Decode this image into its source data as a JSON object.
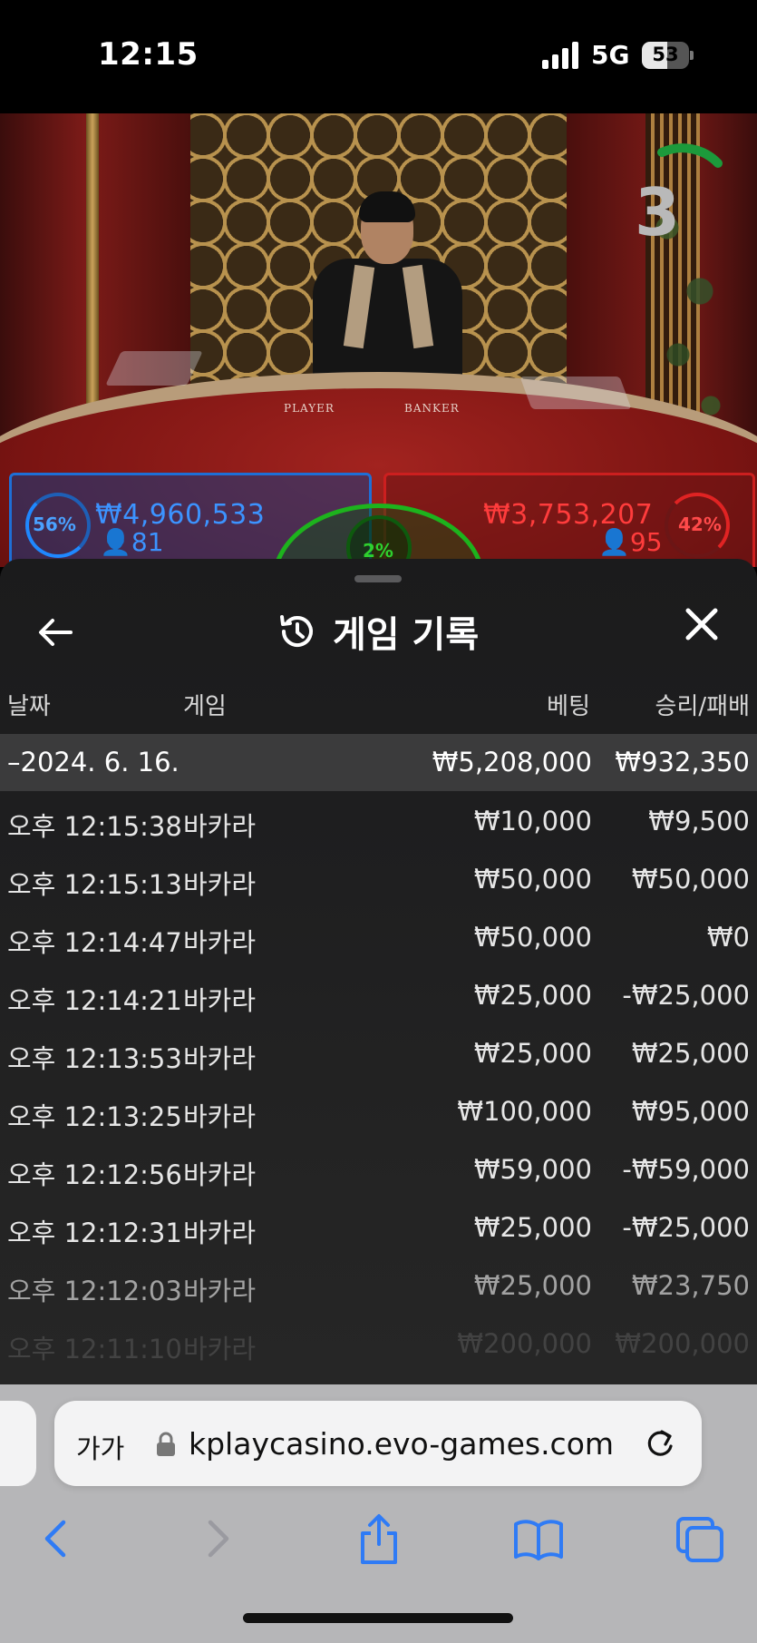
{
  "status_bar": {
    "time": "12:15",
    "network": "5G",
    "battery": "53",
    "battery_level": 0.53
  },
  "game": {
    "countdown": "3",
    "table_labels": {
      "player": "PLAYER",
      "banker": "BANKER"
    },
    "player": {
      "percent": "56%",
      "amount": "₩4,960,533",
      "bettors": "81",
      "color": "#3c93ff"
    },
    "banker": {
      "percent": "42%",
      "amount": "₩3,753,207",
      "bettors": "95",
      "color": "#ff3c3c"
    },
    "tie": {
      "percent": "2%",
      "color": "#2ed02e"
    }
  },
  "history": {
    "title": "게임 기록",
    "columns": {
      "date": "날짜",
      "game": "게임",
      "bet": "베팅",
      "winloss": "승리/패배"
    },
    "summary": {
      "date": "–2024. 6. 16.",
      "bet": "₩5,208,000",
      "winloss": "₩932,350"
    },
    "rows": [
      {
        "time": "오후 12:15:38",
        "game": "바카라",
        "bet": "₩10,000",
        "winloss": "₩9,500"
      },
      {
        "time": "오후 12:15:13",
        "game": "바카라",
        "bet": "₩50,000",
        "winloss": "₩50,000"
      },
      {
        "time": "오후 12:14:47",
        "game": "바카라",
        "bet": "₩50,000",
        "winloss": "₩0"
      },
      {
        "time": "오후 12:14:21",
        "game": "바카라",
        "bet": "₩25,000",
        "winloss": "-₩25,000"
      },
      {
        "time": "오후 12:13:53",
        "game": "바카라",
        "bet": "₩25,000",
        "winloss": "₩25,000"
      },
      {
        "time": "오후 12:13:25",
        "game": "바카라",
        "bet": "₩100,000",
        "winloss": "₩95,000"
      },
      {
        "time": "오후 12:12:56",
        "game": "바카라",
        "bet": "₩59,000",
        "winloss": "-₩59,000"
      },
      {
        "time": "오후 12:12:31",
        "game": "바카라",
        "bet": "₩25,000",
        "winloss": "-₩25,000"
      },
      {
        "time": "오후 12:12:03",
        "game": "바카라",
        "bet": "₩25,000",
        "winloss": "₩23,750"
      },
      {
        "time": "오후 12:11:10",
        "game": "바카라",
        "bet": "₩200,000",
        "winloss": "₩200,000"
      }
    ]
  },
  "browser": {
    "text_size_label": "가가",
    "url": "kplaycasino.evo-games.com",
    "accent": "#2f7bf5"
  }
}
